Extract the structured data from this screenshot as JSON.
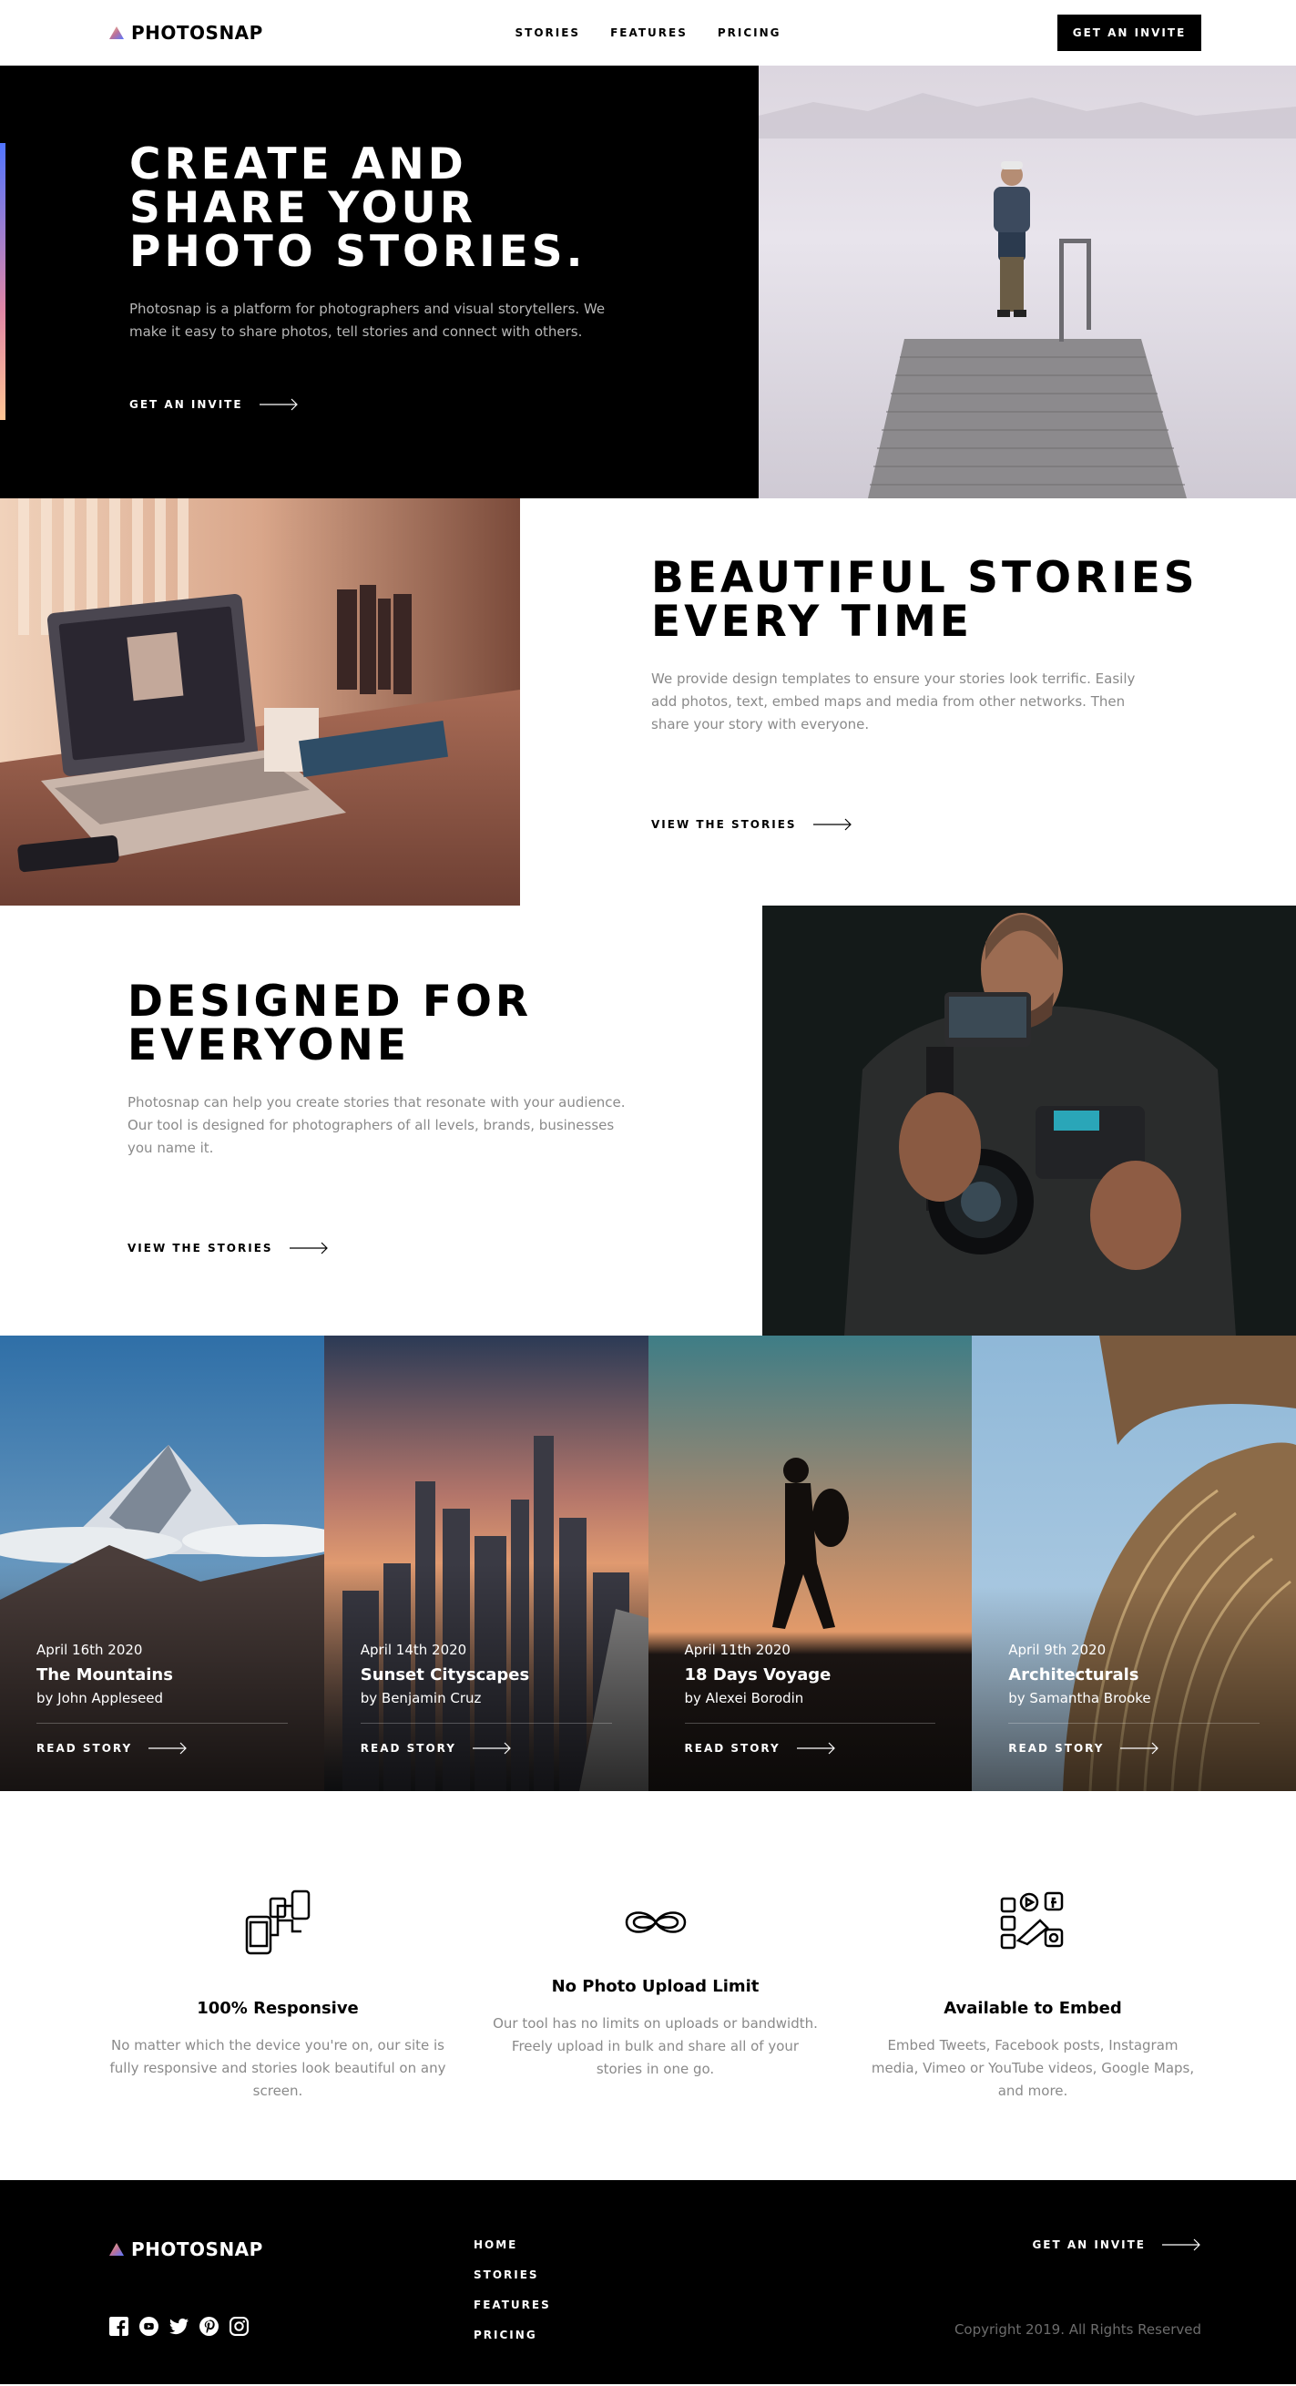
{
  "header": {
    "logo_text": "PHOTOSNAP",
    "nav": [
      "STORIES",
      "FEATURES",
      "PRICING"
    ],
    "cta": "GET AN INVITE"
  },
  "hero": {
    "title": "CREATE AND SHARE YOUR PHOTO STORIES.",
    "description": "Photosnap is a platform for photographers and visual storytellers. We make it easy to share photos, tell stories and connect with others.",
    "link": "GET AN INVITE"
  },
  "beautiful": {
    "title": "BEAUTIFUL STORIES EVERY TIME",
    "description": "We provide design templates to ensure your stories look terrific. Easily add photos, text, embed maps and media from other networks. Then share your story with everyone.",
    "link": "VIEW THE STORIES"
  },
  "designed": {
    "title": "DESIGNED FOR EVERYONE",
    "description": "Photosnap can help you create stories that resonate with your audience. Our tool is designed for photographers of all levels, brands, businesses you name it.",
    "link": "VIEW THE STORIES"
  },
  "stories": [
    {
      "date": "April 16th 2020",
      "title": "The Mountains",
      "author": "by John Appleseed",
      "link": "READ STORY"
    },
    {
      "date": "April 14th 2020",
      "title": "Sunset Cityscapes",
      "author": "by Benjamin Cruz",
      "link": "READ STORY"
    },
    {
      "date": "April 11th 2020",
      "title": "18 Days Voyage",
      "author": "by Alexei Borodin",
      "link": "READ STORY"
    },
    {
      "date": "April 9th 2020",
      "title": "Architecturals",
      "author": "by Samantha Brooke",
      "link": "READ STORY"
    }
  ],
  "features": [
    {
      "icon": "responsive-devices-icon",
      "title": "100% Responsive",
      "description": "No matter which the device you're on, our site is fully responsive and stories look beautiful on any screen."
    },
    {
      "icon": "infinity-icon",
      "title": "No Photo Upload Limit",
      "description": "Our tool has no limits on uploads or bandwidth. Freely upload in bulk and share all of your stories in one go."
    },
    {
      "icon": "embed-icon",
      "title": "Available to Embed",
      "description": "Embed Tweets, Facebook posts, Instagram media, Vimeo or YouTube videos, Google Maps, and more."
    }
  ],
  "footer": {
    "logo_text": "PHOTOSNAP",
    "nav": [
      "HOME",
      "STORIES",
      "FEATURES",
      "PRICING"
    ],
    "cta": "GET AN INVITE",
    "copyright": "Copyright 2019. All Rights Reserved",
    "socials": [
      "facebook-icon",
      "youtube-icon",
      "twitter-icon",
      "pinterest-icon",
      "instagram-icon"
    ]
  },
  "colors": {
    "accent_gradient": [
      "#5175ff",
      "#e086a6",
      "#ffc593"
    ],
    "dark": "#000000",
    "muted_text": "#8a8a8a"
  }
}
